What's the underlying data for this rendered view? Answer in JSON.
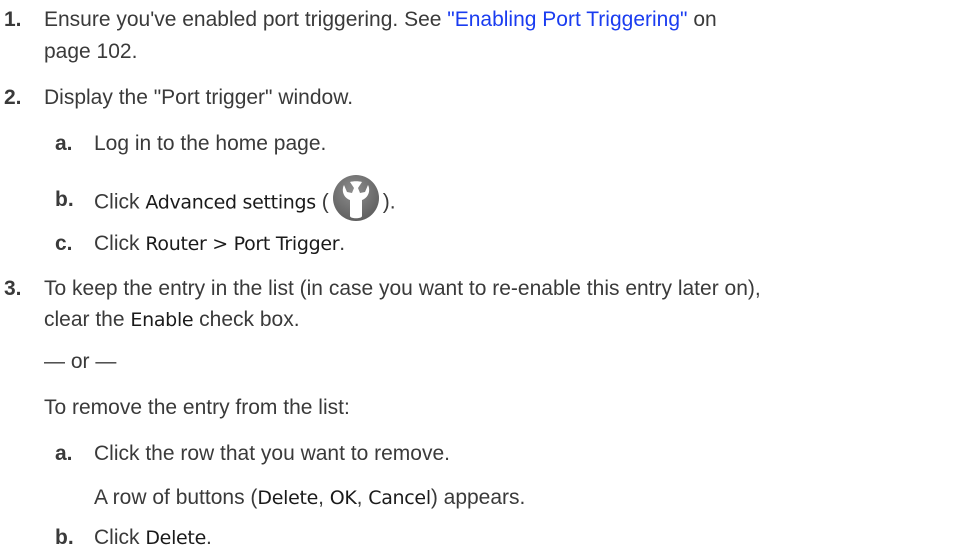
{
  "steps": [
    {
      "num": "1.",
      "line1_pre": "Ensure you've enabled port triggering. See ",
      "line1_link": "\"Enabling Port Triggering\"",
      "line1_post": " on",
      "line2": "page 102."
    },
    {
      "num": "2.",
      "text": "Display the \"Port trigger\" window.",
      "substeps": [
        {
          "num": "a.",
          "text": "Log in to the home page."
        },
        {
          "num": "b.",
          "pre": "Click ",
          "ui": "Advanced settings",
          "open": " (",
          "icon": "wrench-icon",
          "close": ")."
        },
        {
          "num": "c.",
          "pre": "Click ",
          "ui": "Router > Port Trigger",
          "post": "."
        }
      ]
    },
    {
      "num": "3.",
      "line1": "To keep the entry in the list (in case you want to re-enable this entry later on),",
      "line2_pre": "clear the ",
      "line2_ui": "Enable",
      "line2_post": " check box.",
      "or": "— or —",
      "alt": "To remove the entry from the list:",
      "substeps": [
        {
          "num": "a.",
          "text": "Click the row that you want to remove.",
          "note_pre": "A row of buttons (",
          "note_ui1": "Delete",
          "note_sep1": ", ",
          "note_ui2": "OK",
          "note_sep2": ", ",
          "note_ui3": "Cancel",
          "note_post": ") appears."
        },
        {
          "num": "b.",
          "pre": "Click ",
          "ui": "Delete",
          "post": "."
        }
      ]
    }
  ]
}
